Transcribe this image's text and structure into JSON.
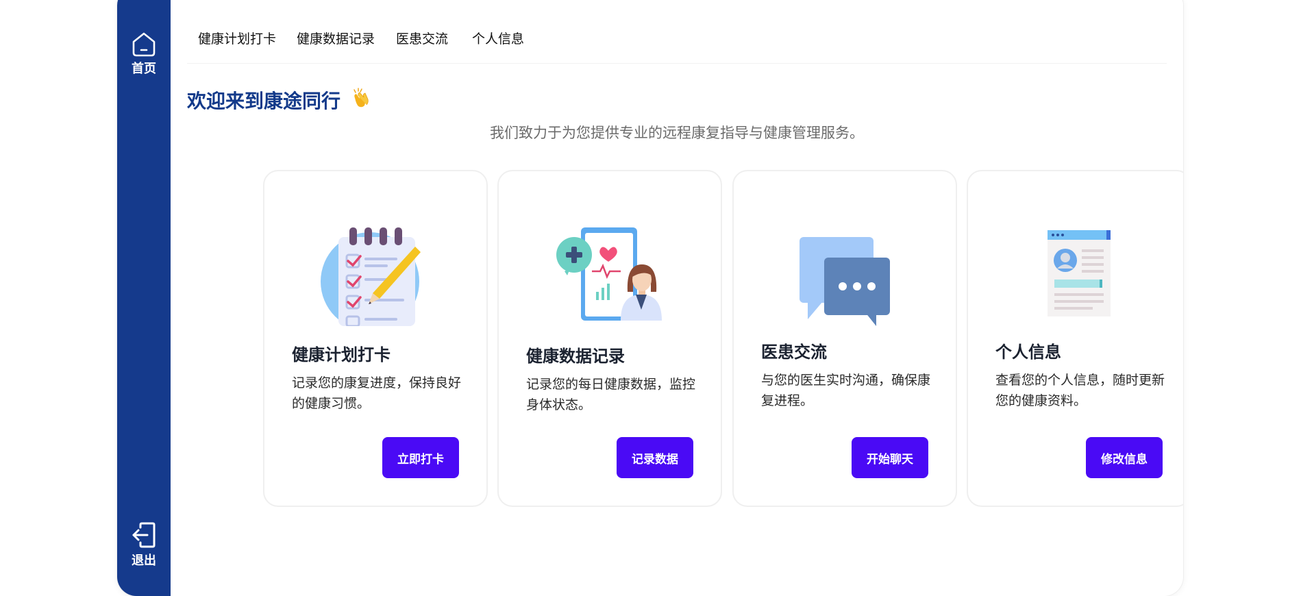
{
  "sidebar": {
    "home_label": "首页",
    "exit_label": "退出"
  },
  "nav": {
    "items": [
      "健康计划打卡",
      "健康数据记录",
      "医患交流",
      "个人信息"
    ]
  },
  "welcome": {
    "title": "欢迎来到康途同行",
    "emoji": "👏",
    "subtitle": "我们致力于为您提供专业的远程康复指导与健康管理服务。"
  },
  "cards": [
    {
      "title": "健康计划打卡",
      "desc": "记录您的康复进度，保持良好的健康习惯。",
      "button": "立即打卡",
      "icon": "checklist-icon"
    },
    {
      "title": "健康数据记录",
      "desc": "记录您的每日健康数据，监控身体状态。",
      "button": "记录数据",
      "icon": "doctor-health-data-icon"
    },
    {
      "title": "医患交流",
      "desc": "与您的医生实时沟通，确保康复进程。",
      "button": "开始聊天",
      "icon": "chat-bubbles-icon"
    },
    {
      "title": "个人信息",
      "desc": "查看您的个人信息，随时更新您的健康资料。",
      "button": "修改信息",
      "icon": "profile-document-icon"
    }
  ],
  "colors": {
    "sidebar": "#153a8c",
    "title": "#133a8a",
    "button": "#4a0af5"
  }
}
